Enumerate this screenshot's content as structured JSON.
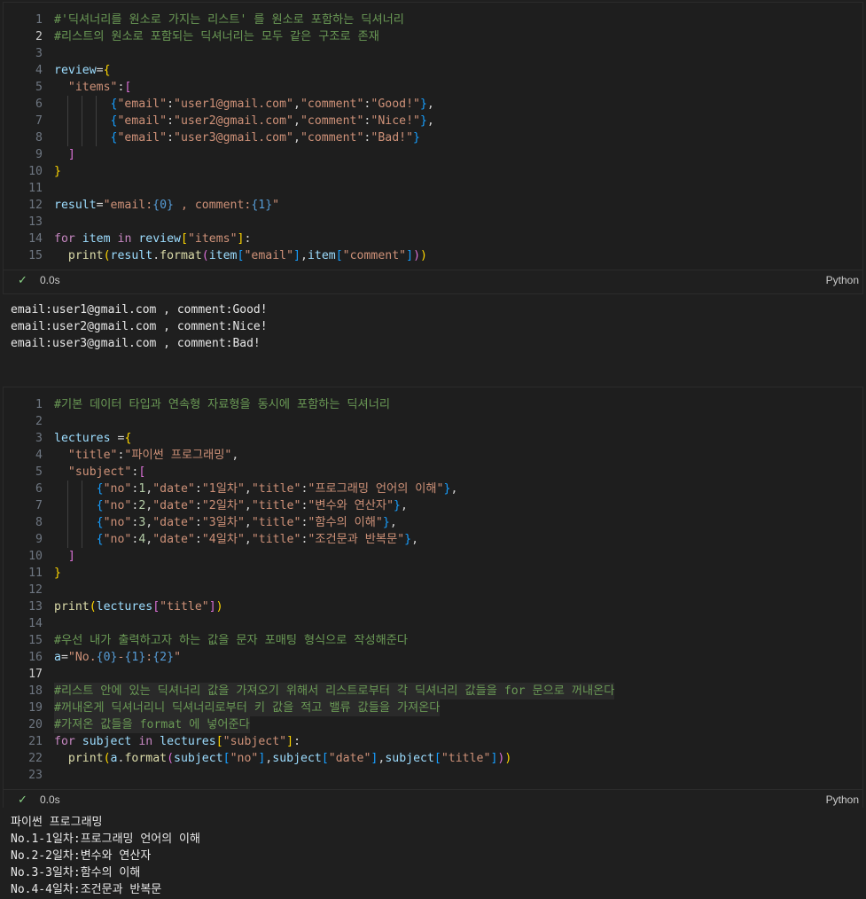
{
  "cell1": {
    "lines": [
      "#'딕셔너리를 원소로 가지는 리스트' 를 원소로 포함하는 딕셔너리",
      "#리스트의 원소로 포함되는 딕셔너리는 모두 같은 구조로 존재",
      "",
      "review={",
      "  \"items\":[",
      "        {\"email\":\"user1@gmail.com\",\"comment\":\"Good!\"},",
      "        {\"email\":\"user2@gmail.com\",\"comment\":\"Nice!\"},",
      "        {\"email\":\"user3@gmail.com\",\"comment\":\"Bad!\"}",
      "  ]",
      "}",
      "",
      "result=\"email:{0} , comment:{1}\"",
      "",
      "for item in review[\"items\"]:",
      "  print(result.format(item[\"email\"],item[\"comment\"]))"
    ],
    "active_line": 2,
    "status_time": "0.0s",
    "status_lang": "Python",
    "output": [
      "email:user1@gmail.com , comment:Good!",
      "email:user2@gmail.com , comment:Nice!",
      "email:user3@gmail.com , comment:Bad!"
    ]
  },
  "cell2": {
    "lines": [
      "#기본 데이터 타입과 연속형 자료형을 동시에 포함하는 딕셔너리",
      "",
      "lectures ={",
      "  \"title\":\"파이썬 프로그래밍\",",
      "  \"subject\":[",
      "      {\"no\":1,\"date\":\"1일차\",\"title\":\"프로그래밍 언어의 이해\"},",
      "      {\"no\":2,\"date\":\"2일차\",\"title\":\"변수와 연산자\"},",
      "      {\"no\":3,\"date\":\"3일차\",\"title\":\"함수의 이해\"},",
      "      {\"no\":4,\"date\":\"4일차\",\"title\":\"조건문과 반복문\"},",
      "  ]",
      "}",
      "",
      "print(lectures[\"title\"])",
      "",
      "#우선 내가 출력하고자 하는 값을 문자 포매팅 형식으로 작성해준다",
      "a=\"No.{0}-{1}:{2}\"",
      "",
      "#리스트 안에 있는 딕셔너리 값을 가져오기 위해서 리스트로부터 각 딕셔너리 값들을 for 문으로 꺼내온다",
      "#꺼내온게 딕셔너리니 딕셔너리로부터 키 값을 적고 밸류 값들을 가져온다",
      "#가져온 값들을 format 에 넣어준다",
      "for subject in lectures[\"subject\"]:",
      "  print(a.format(subject[\"no\"],subject[\"date\"],subject[\"title\"]))",
      ""
    ],
    "active_line": 17,
    "status_time": "0.0s",
    "status_lang": "Python",
    "output": [
      "파이썬 프로그래밍",
      "No.1-1일차:프로그래밍 언어의 이해",
      "No.2-2일차:변수와 연산자",
      "No.3-3일차:함수의 이해",
      "No.4-4일차:조건문과 반복문"
    ]
  },
  "status_icon": "check-icon"
}
